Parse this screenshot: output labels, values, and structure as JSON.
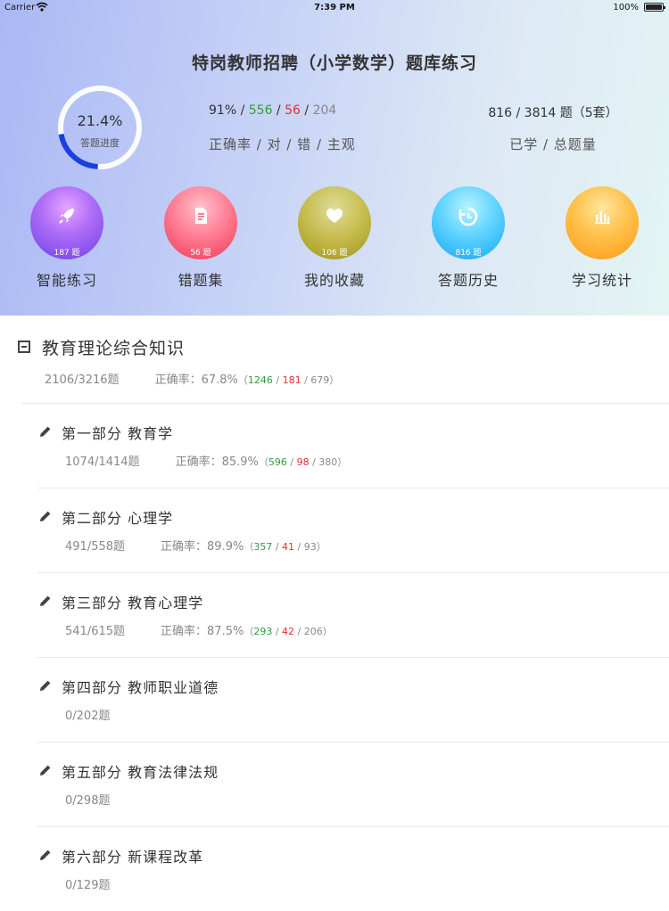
{
  "status_bar": {
    "carrier": "Carrier",
    "time": "7:39 PM",
    "battery": "100%"
  },
  "header": {
    "title": "特岗教师招聘（小学数学）题库练习",
    "progress_ring": {
      "percent_text": "21.4%",
      "label": "答题进度",
      "value": 0.214
    },
    "stats": {
      "accuracy": "91%",
      "correct": "556",
      "wrong": "56",
      "subjective": "204",
      "caption": "正确率 / 对 / 错 / 主观",
      "sep": " / "
    },
    "progress": {
      "values": "816 / 3814 题（5套）",
      "caption": "已学 / 总题量"
    }
  },
  "shortcuts": [
    {
      "label": "智能练习",
      "count": "187 题",
      "icon": "rocket-icon"
    },
    {
      "label": "错题集",
      "count": "56 题",
      "icon": "document-icon"
    },
    {
      "label": "我的收藏",
      "count": "106 题",
      "icon": "heart-icon"
    },
    {
      "label": "答题历史",
      "count": "816 题",
      "icon": "history-icon"
    },
    {
      "label": "学习统计",
      "count": "",
      "icon": "bar-chart-icon"
    }
  ],
  "category": {
    "title": "教育理论综合知识",
    "progress": "2106/3216题",
    "accuracy_label": "正确率：",
    "accuracy": "67.8%",
    "open": "（",
    "correct": "1246",
    "wrong": "181",
    "other": "679",
    "close": "）",
    "sep": " / ",
    "items": [
      {
        "title": "第一部分 教育学",
        "progress": "1074/1414题",
        "accuracy_label": "正确率：",
        "accuracy": "85.9%",
        "open": "（",
        "correct": "596",
        "wrong": "98",
        "other": "380",
        "close": "）"
      },
      {
        "title": "第二部分 心理学",
        "progress": "491/558题",
        "accuracy_label": "正确率：",
        "accuracy": "89.9%",
        "open": "（",
        "correct": "357",
        "wrong": "41",
        "other": "93",
        "close": "）"
      },
      {
        "title": "第三部分 教育心理学",
        "progress": "541/615题",
        "accuracy_label": "正确率：",
        "accuracy": "87.5%",
        "open": "（",
        "correct": "293",
        "wrong": "42",
        "other": "206",
        "close": "）"
      },
      {
        "title": "第四部分 教师职业道德",
        "progress": "0/202题"
      },
      {
        "title": "第五部分 教育法律法规",
        "progress": "0/298题"
      },
      {
        "title": "第六部分 新课程改革",
        "progress": "0/129题"
      }
    ]
  },
  "colors": {
    "correct": "#2e9e3e",
    "wrong": "#e03030",
    "ring": "#1a3fe0"
  }
}
